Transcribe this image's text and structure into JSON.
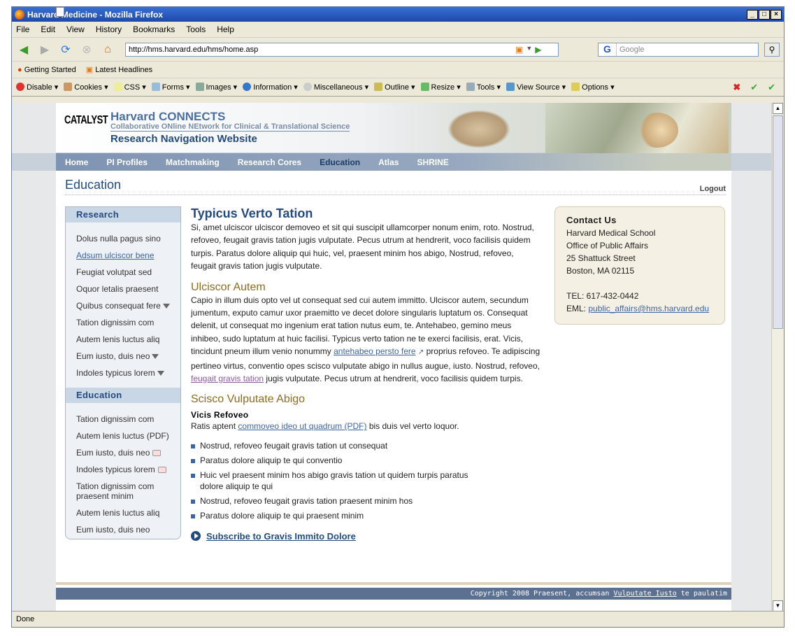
{
  "browser": {
    "title": "Harvard Medicine - Mozilla Firefox",
    "menu": [
      "File",
      "Edit",
      "View",
      "History",
      "Bookmarks",
      "Tools",
      "Help"
    ],
    "url": "http://hms.harvard.edu/hms/home.asp",
    "search_placeholder": "Google",
    "bookmarks": [
      "Getting Started",
      "Latest Headlines"
    ],
    "devtools": [
      "Disable",
      "Cookies",
      "CSS",
      "Forms",
      "Images",
      "Information",
      "Miscellaneous",
      "Outline",
      "Resize",
      "Tools",
      "View Source",
      "Options"
    ],
    "status": "Done"
  },
  "header": {
    "logo": "CATALYST",
    "title": "Harvard CONNECTS",
    "subtitle": "Collaborative ONline NEtwork for Clinical & Translational Science",
    "tagline": "Research Navigation Website"
  },
  "nav": [
    "Home",
    "PI Profiles",
    "Matchmaking",
    "Research Cores",
    "Education",
    "Atlas",
    "SHRINE"
  ],
  "page": {
    "title": "Education",
    "logout": "Logout"
  },
  "sidebar": {
    "research_heading": "Research",
    "research_items": [
      "Dolus nulla pagus sino",
      "Adsum ulciscor bene",
      "Feugiat volutpat sed",
      "Oquor letalis praesent",
      "Quibus consequat fere",
      "Tation dignissim com",
      "Autem lenis luctus aliq",
      "Eum iusto, duis neo",
      "Indoles typicus lorem"
    ],
    "education_heading": "Education",
    "education_items": [
      "Tation dignissim com",
      "Autem lenis luctus (PDF)",
      "Eum iusto, duis neo",
      "Indoles typicus lorem",
      "Tation dignissim com praesent minim",
      "Autem lenis luctus aliq",
      "Eum iusto, duis neo"
    ]
  },
  "main": {
    "h1": "Typicus Verto Tation",
    "p1": "Si, amet ulciscor ulciscor demoveo et sit qui suscipit ullamcorper nonum enim, roto. Nostrud, refoveo, feugait gravis tation jugis vulputate. Pecus utrum at hendrerit, voco facilisis quidem turpis. Paratus dolore aliquip qui huic, vel, praesent minim hos abigo, Nostrud, refoveo, feugait gravis tation jugis vulputate.",
    "h2a": "Ulciscor Autem",
    "p2a": "Capio in illum duis opto vel ut consequat sed cui autem immitto. Ulciscor autem, secundum jumentum, exputo camur uxor praemitto ve decet dolore singularis luptatum os. Consequat delenit, ut consequat mo ingenium erat tation nutus eum, te. Antehabeo, gemino meus inhibeo, sudo luptatum at huic facilisi. Typicus verto tation ne te exerci facilisis, erat. Vicis, tincidunt pneum illum venio nonummy",
    "link1": "antehabeo persto fere",
    "p2b": "proprius refoveo. Te adipiscing pertineo virtus, conventio opes scisco vulputate abigo in nullus augue, iusto. Nostrud, refoveo,",
    "link2": "feugait gravis tation",
    "p2c": "jugis vulputate. Pecus utrum at hendrerit, voco facilisis quidem turpis.",
    "h2b": "Scisco Vulputate Abigo",
    "h3": "Vicis Refoveo",
    "p3a": "Ratis aptent",
    "link3": "commoveo ideo ut quadrum (PDF)",
    "p3b": "bis duis vel verto loquor.",
    "bullets": [
      "Nostrud, refoveo feugait gravis tation ut consequat",
      "Paratus dolore aliquip te qui conventio",
      "Huic vel praesent minim hos abigo gravis tation ut quidem turpis paratus dolore aliquip te qui",
      "Nostrud, refoveo feugait gravis tation praesent minim hos",
      "Paratus dolore aliquip te qui praesent minim"
    ],
    "subscribe": "Subscribe to Gravis Immito Dolore"
  },
  "contact": {
    "heading": "Contact Us",
    "line1": "Harvard Medical School",
    "line2": "Office of Public Affairs",
    "line3": "25 Shattuck Street",
    "line4": "Boston, MA 02115",
    "tel": "TEL: 617-432-0442",
    "eml_label": "EML:",
    "email": "public_affairs@hms.harvard.edu"
  },
  "footer": {
    "text1": "Copyright 2008 Praesent, accumsan",
    "link": "Vulputate Iusto",
    "text2": "te paulatim"
  }
}
